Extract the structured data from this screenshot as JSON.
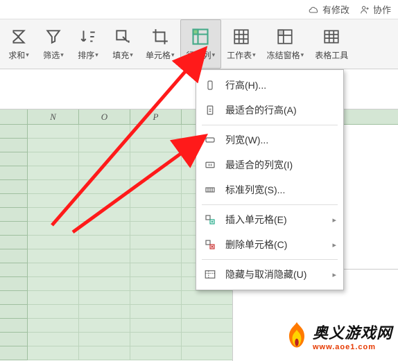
{
  "topbar": {
    "modified": "有修改",
    "collab": "协作"
  },
  "toolbar": [
    {
      "id": "sum",
      "label": "求和"
    },
    {
      "id": "filter",
      "label": "筛选"
    },
    {
      "id": "sort",
      "label": "排序"
    },
    {
      "id": "fill",
      "label": "填充"
    },
    {
      "id": "cell",
      "label": "单元格"
    },
    {
      "id": "rowcol",
      "label": "行和列"
    },
    {
      "id": "worksheet",
      "label": "工作表"
    },
    {
      "id": "freeze",
      "label": "冻结窗格"
    },
    {
      "id": "tabletools",
      "label": "表格工具"
    }
  ],
  "columns": [
    "N",
    "O",
    "P"
  ],
  "dropdown": [
    {
      "id": "rowheight",
      "label": "行高(H)..."
    },
    {
      "id": "bestrowheight",
      "label": "最适合的行高(A)"
    },
    {
      "sep": true
    },
    {
      "id": "colwidth",
      "label": "列宽(W)..."
    },
    {
      "id": "bestcolwidth",
      "label": "最适合的列宽(I)"
    },
    {
      "id": "stdcolwidth",
      "label": "标准列宽(S)..."
    },
    {
      "sep": true
    },
    {
      "id": "insertcell",
      "label": "插入单元格(E)",
      "sub": true
    },
    {
      "id": "deletecell",
      "label": "删除单元格(C)",
      "sub": true
    },
    {
      "sep": true
    },
    {
      "id": "hideunhide",
      "label": "隐藏与取消隐藏(U)",
      "sub": true
    }
  ],
  "watermark": {
    "title": "奥义游戏网",
    "url": "www.aoe1.com"
  }
}
